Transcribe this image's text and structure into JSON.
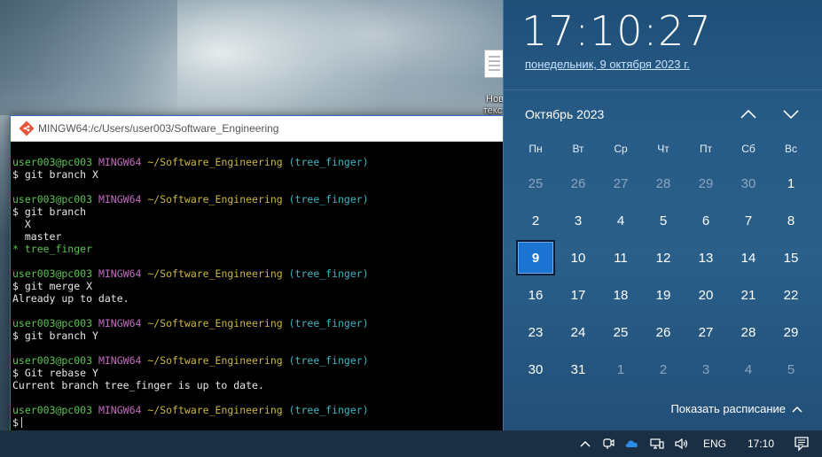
{
  "desktop": {
    "icon_label": "Нов\nтекст"
  },
  "terminal": {
    "title": "MINGW64:/c/Users/user003/Software_Engineering",
    "blocks": [
      {
        "user": "user003@pc003",
        "shell": "MINGW64",
        "path": "~/Software_Engineering",
        "branch": "(tree_finger)",
        "cmd": "$ git branch X",
        "out": []
      },
      {
        "user": "user003@pc003",
        "shell": "MINGW64",
        "path": "~/Software_Engineering",
        "branch": "(tree_finger)",
        "cmd": "$ git branch",
        "out": [
          "  X",
          "  master"
        ],
        "current": "* tree_finger"
      },
      {
        "user": "user003@pc003",
        "shell": "MINGW64",
        "path": "~/Software_Engineering",
        "branch": "(tree_finger)",
        "cmd": "$ git merge X",
        "out": [
          "Already up to date."
        ]
      },
      {
        "user": "user003@pc003",
        "shell": "MINGW64",
        "path": "~/Software_Engineering",
        "branch": "(tree_finger)",
        "cmd": "$ git branch Y",
        "out": []
      },
      {
        "user": "user003@pc003",
        "shell": "MINGW64",
        "path": "~/Software_Engineering",
        "branch": "(tree_finger)",
        "cmd": "$ Git rebase Y",
        "out": [
          "Current branch tree_finger is up to date."
        ]
      },
      {
        "user": "user003@pc003",
        "shell": "MINGW64",
        "path": "~/Software_Engineering",
        "branch": "(tree_finger)",
        "cmd": "$",
        "out": [],
        "cursor": true
      }
    ]
  },
  "clock": {
    "time": "17:10:27",
    "date": "понедельник, 9 октября 2023 г."
  },
  "calendar": {
    "month_label": "Октябрь 2023",
    "weekdays": [
      "Пн",
      "Вт",
      "Ср",
      "Чт",
      "Пт",
      "Сб",
      "Вс"
    ],
    "days": [
      {
        "d": "25",
        "other": true
      },
      {
        "d": "26",
        "other": true
      },
      {
        "d": "27",
        "other": true
      },
      {
        "d": "28",
        "other": true
      },
      {
        "d": "29",
        "other": true
      },
      {
        "d": "30",
        "other": true
      },
      {
        "d": "1"
      },
      {
        "d": "2"
      },
      {
        "d": "3"
      },
      {
        "d": "4"
      },
      {
        "d": "5"
      },
      {
        "d": "6"
      },
      {
        "d": "7"
      },
      {
        "d": "8"
      },
      {
        "d": "9",
        "today": true
      },
      {
        "d": "10"
      },
      {
        "d": "11"
      },
      {
        "d": "12"
      },
      {
        "d": "13"
      },
      {
        "d": "14"
      },
      {
        "d": "15"
      },
      {
        "d": "16"
      },
      {
        "d": "17"
      },
      {
        "d": "18"
      },
      {
        "d": "19"
      },
      {
        "d": "20"
      },
      {
        "d": "21"
      },
      {
        "d": "22"
      },
      {
        "d": "23"
      },
      {
        "d": "24"
      },
      {
        "d": "25"
      },
      {
        "d": "26"
      },
      {
        "d": "27"
      },
      {
        "d": "28"
      },
      {
        "d": "29"
      },
      {
        "d": "30"
      },
      {
        "d": "31"
      },
      {
        "d": "1",
        "other": true
      },
      {
        "d": "2",
        "other": true
      },
      {
        "d": "3",
        "other": true
      },
      {
        "d": "4",
        "other": true
      },
      {
        "d": "5",
        "other": true
      }
    ],
    "show_schedule_label": "Показать расписание"
  },
  "taskbar": {
    "language": "ENG",
    "time": "17:10",
    "tray_icons": [
      "chevron-up-icon",
      "meet-now-icon",
      "onedrive-cloud-icon",
      "network-icon",
      "volume-icon"
    ]
  },
  "colors": {
    "prompt_user": "#59c44e",
    "prompt_shell": "#c36ac0",
    "prompt_path": "#c9b443",
    "prompt_branch": "#3fb5c2",
    "today_highlight": "#1a73d1"
  }
}
